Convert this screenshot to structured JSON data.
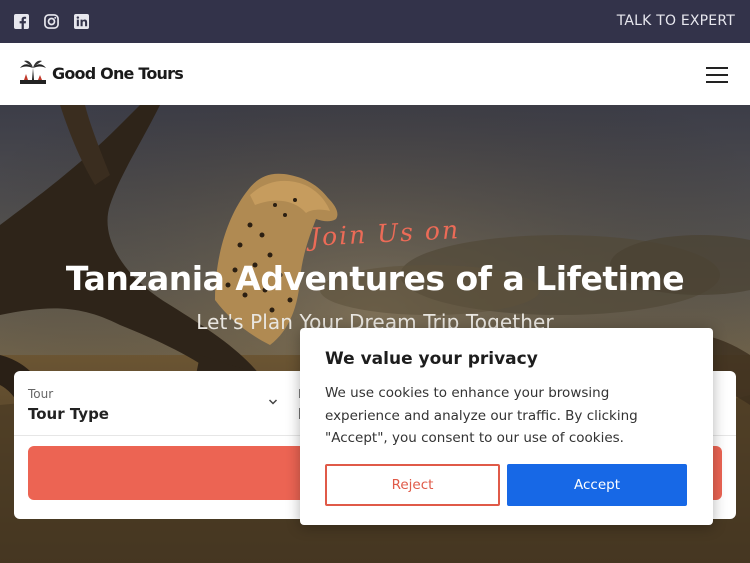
{
  "topbar": {
    "social": [
      "facebook-icon",
      "instagram-icon",
      "linkedin-icon"
    ],
    "cta_label": "TALK TO EXPERT"
  },
  "header": {
    "brand": "Good One Tours",
    "menu_icon": "hamburger-icon"
  },
  "hero": {
    "script": "Join Us on",
    "title": "Tanzania Adventures of a Lifetime",
    "subtitle": "Let's Plan Your Dream Trip Together"
  },
  "search": {
    "tour_label": "Tour",
    "tour_value": "Tour Type",
    "second_label": "I",
    "second_value": "I"
  },
  "cookie": {
    "title": "We value your privacy",
    "body": "We use cookies to enhance your browsing experience and analyze our traffic. By clicking \"Accept\", you consent to our use of cookies.",
    "reject_label": "Reject",
    "accept_label": "Accept"
  },
  "colors": {
    "topbar": "#33334a",
    "accent": "#ec6453",
    "accept": "#1768e6"
  }
}
